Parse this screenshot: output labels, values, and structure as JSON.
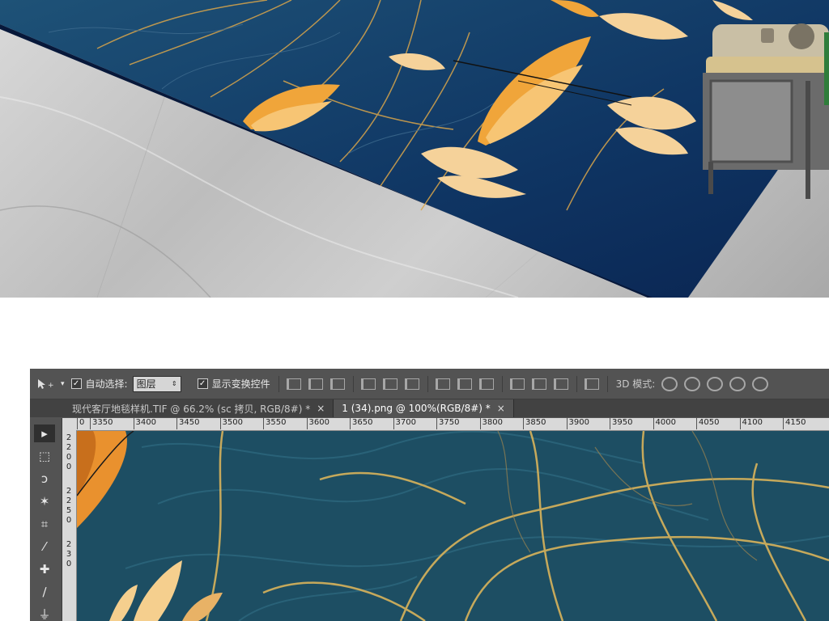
{
  "colors": {
    "carpet_dark": "#0d2a57",
    "carpet_mid": "#1e5277",
    "gold": "#e7a63c",
    "gold_light": "#f6d7a0",
    "canvas_bg": "#1d4e63",
    "ps_panel": "#535353"
  },
  "options_bar": {
    "move_tool_icon": "move-icon",
    "auto_select_label": "自动选择:",
    "auto_select_checked": true,
    "auto_select_value": "图层",
    "show_transform_label": "显示变换控件",
    "show_transform_checked": true,
    "mode_3d_label": "3D 模式:"
  },
  "tabs": [
    {
      "label": "现代客厅地毯样机.TIF @ 66.2% (sc 拷贝, RGB/8#) *",
      "close": "×",
      "active": false
    },
    {
      "label": "1 (34).png @ 100%(RGB/8#) *",
      "close": "×",
      "active": true
    }
  ],
  "ruler": {
    "h_ticks": [
      "0",
      "3350",
      "3400",
      "3450",
      "3500",
      "3550",
      "3600",
      "3650",
      "3700",
      "3750",
      "3800",
      "3850",
      "3900",
      "3950",
      "4000",
      "4050",
      "4100",
      "4150"
    ],
    "v_labels": [
      "2",
      "2",
      "0",
      "0",
      "2",
      "2",
      "5",
      "0",
      "2",
      "3",
      "0"
    ]
  },
  "tools": [
    {
      "name": "move-tool",
      "glyph": "▸"
    },
    {
      "name": "marquee-tool",
      "glyph": "⬚"
    },
    {
      "name": "lasso-tool",
      "glyph": "ↄ"
    },
    {
      "name": "magic-wand-tool",
      "glyph": "✶"
    },
    {
      "name": "crop-tool",
      "glyph": "⌗"
    },
    {
      "name": "eyedropper-tool",
      "glyph": "⁄"
    },
    {
      "name": "healing-brush-tool",
      "glyph": "✚"
    },
    {
      "name": "brush-tool",
      "glyph": "∕"
    },
    {
      "name": "clone-stamp-tool",
      "glyph": "⏚"
    }
  ]
}
